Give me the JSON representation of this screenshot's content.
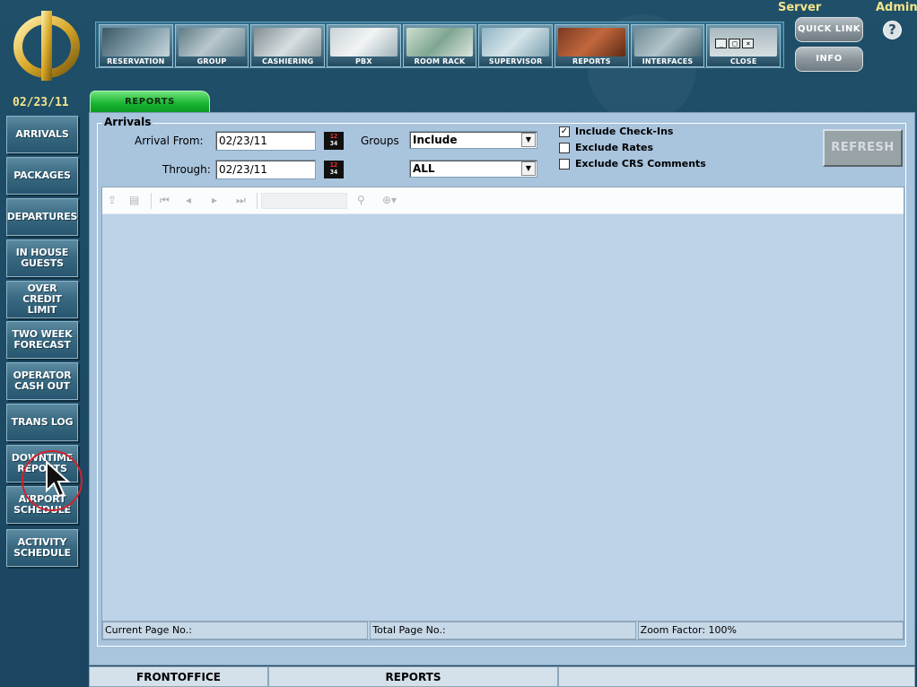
{
  "header": {
    "server_label": "Server",
    "admin_label": "Admin",
    "quick_link_label": "QUICK LINK",
    "info_label": "INFO",
    "help_label": "?"
  },
  "modules": [
    {
      "label": "RESERVATION"
    },
    {
      "label": "GROUP"
    },
    {
      "label": "CASHIERING"
    },
    {
      "label": "PBX"
    },
    {
      "label": "ROOM RACK"
    },
    {
      "label": "SUPERVISOR"
    },
    {
      "label": "REPORTS"
    },
    {
      "label": "INTERFACES"
    },
    {
      "label": "CLOSE"
    }
  ],
  "current_date": "02/23/11",
  "active_tab": "REPORTS",
  "sidebar": {
    "items": [
      {
        "label": "ARRIVALS"
      },
      {
        "label": "PACKAGES"
      },
      {
        "label": "DEPARTURES"
      },
      {
        "label": "IN HOUSE GUESTS"
      },
      {
        "label": "OVER CREDIT LIMIT"
      },
      {
        "label": "TWO WEEK FORECAST"
      },
      {
        "label": "OPERATOR CASH OUT"
      },
      {
        "label": "TRANS LOG"
      },
      {
        "label": "DOWNTIME REPORTS"
      },
      {
        "label": "AIRPORT SCHEDULE"
      },
      {
        "label": "ACTIVITY SCHEDULE"
      }
    ]
  },
  "form": {
    "group_title": "Arrivals",
    "arrival_from_label": "Arrival From:",
    "arrival_from_value": "02/23/11",
    "through_label": "Through:",
    "through_value": "02/23/11",
    "groups_label": "Groups",
    "groups_value": "Include",
    "second_select_value": "ALL",
    "include_checkins_label": "Include Check-Ins",
    "include_checkins_checked": true,
    "exclude_rates_label": "Exclude Rates",
    "exclude_rates_checked": false,
    "exclude_crs_label": "Exclude CRS Comments",
    "exclude_crs_checked": false,
    "refresh_label": "REFRESH",
    "calendar_icon_top": "12",
    "calendar_icon_bottom": "34"
  },
  "viewer": {
    "current_page_label": "Current Page No.:",
    "total_page_label": "Total Page No.:",
    "zoom_label": "Zoom Factor: 100%"
  },
  "bottom_bar": {
    "left": "FRONTOFFICE",
    "middle": "REPORTS",
    "right": ""
  },
  "colors": {
    "background": "#1d4a63",
    "accent_yellow": "#f4e58a",
    "tab_green": "#18b331",
    "panel": "#a9c4dd"
  }
}
